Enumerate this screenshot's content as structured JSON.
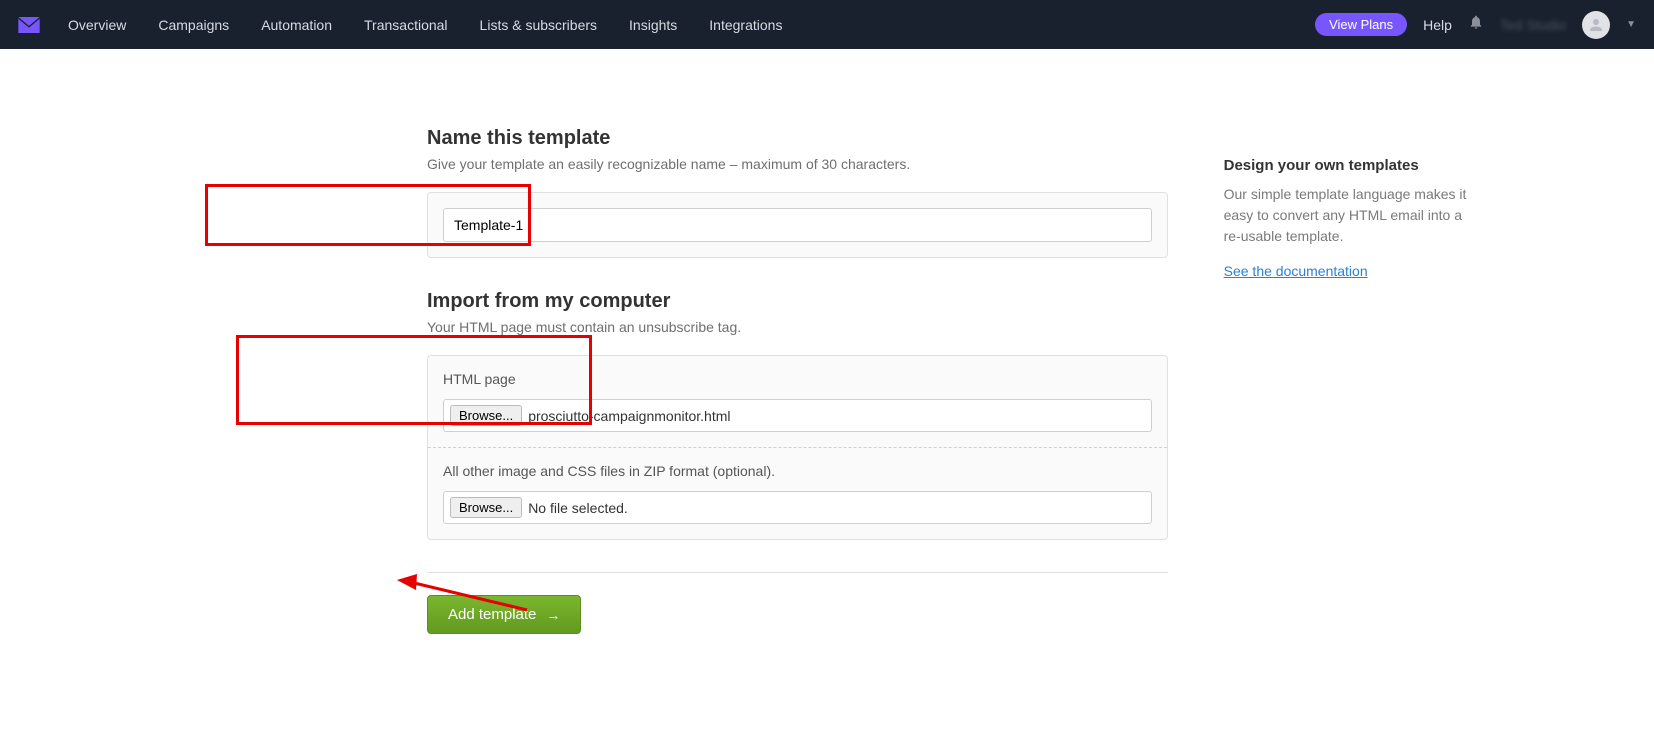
{
  "nav": {
    "items": [
      "Overview",
      "Campaigns",
      "Automation",
      "Transactional",
      "Lists & subscribers",
      "Insights",
      "Integrations"
    ],
    "view_plans": "View Plans",
    "help": "Help",
    "user_name": "Ted Studio"
  },
  "name_section": {
    "heading": "Name this template",
    "subtitle": "Give your template an easily recognizable name – maximum of 30 characters.",
    "value": "Template-1"
  },
  "import_section": {
    "heading": "Import from my computer",
    "subtitle": "Your HTML page must contain an unsubscribe tag.",
    "html_label": "HTML page",
    "browse_label": "Browse...",
    "html_file": "prosciutto-campaignmonitor.html",
    "zip_label": "All other image and CSS files in ZIP format (optional).",
    "zip_file": "No file selected."
  },
  "submit": {
    "label": "Add template"
  },
  "sidebar": {
    "heading": "Design your own templates",
    "text": "Our simple template language makes it easy to convert any HTML email into a re-usable template.",
    "link": "See the documentation"
  }
}
